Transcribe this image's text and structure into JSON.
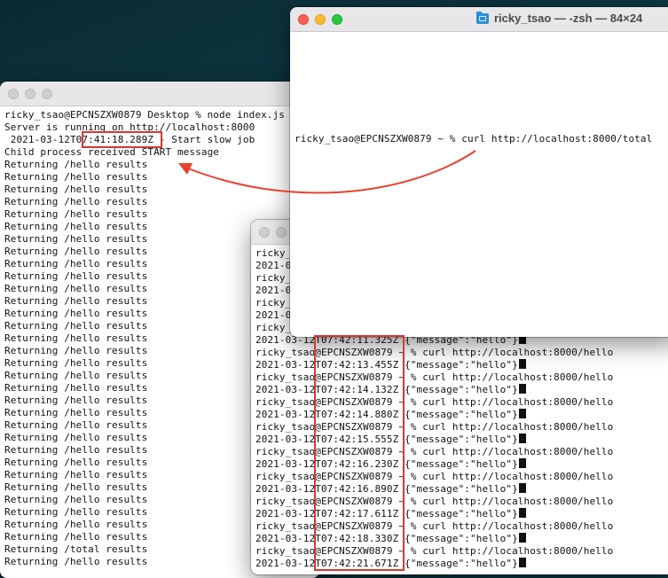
{
  "win_c": {
    "title": "ricky_tsao — -zsh — 84×24",
    "lines": [
      "ricky_tsao@EPCNSZXW0879 ~ % curl http://localhost:8000/total"
    ]
  },
  "win_a": {
    "lines": [
      "ricky_tsao@EPCNSZXW0879 Desktop % node index.js",
      "Server is running on http://localhost:8000",
      " 2021-03-12T07:41:18.289Z - Start slow job",
      "Child process received START message",
      "Returning /hello results",
      "Returning /hello results",
      "Returning /hello results",
      "Returning /hello results",
      "Returning /hello results",
      "Returning /hello results",
      "Returning /hello results",
      "Returning /hello results",
      "Returning /hello results",
      "Returning /hello results",
      "Returning /hello results",
      "Returning /hello results",
      "Returning /hello results",
      "Returning /hello results",
      "Returning /hello results",
      "Returning /hello results",
      "Returning /hello results",
      "Returning /hello results",
      "Returning /hello results",
      "Returning /hello results",
      "Returning /hello results",
      "Returning /hello results",
      "Returning /hello results",
      "Returning /hello results",
      "Returning /hello results",
      "Returning /hello results",
      "Returning /hello results",
      "Returning /hello results",
      "Returning /hello results",
      "Returning /hello results",
      "Returning /hello results",
      "Returning /total results",
      "Returning /hello results"
    ]
  },
  "win_b": {
    "lines": [
      "ricky_",
      "2021-0",
      "ricky_",
      "2021-0",
      "ricky_",
      "2021-0",
      "ricky_",
      "2021-03-12T07:42:11.325Z {\"message\":\"hello\"}",
      "ricky_tsao@EPCNSZXW0879 ~ % curl http://localhost:8000/hello",
      "2021-03-12T07:42:13.455Z {\"message\":\"hello\"}",
      "ricky_tsao@EPCNSZXW0879 ~ % curl http://localhost:8000/hello",
      "2021-03-12T07:42:14.132Z {\"message\":\"hello\"}",
      "ricky_tsao@EPCNSZXW0879 ~ % curl http://localhost:8000/hello",
      "2021-03-12T07:42:14.880Z {\"message\":\"hello\"}",
      "ricky_tsao@EPCNSZXW0879 ~ % curl http://localhost:8000/hello",
      "2021-03-12T07:42:15.555Z {\"message\":\"hello\"}",
      "ricky_tsao@EPCNSZXW0879 ~ % curl http://localhost:8000/hello",
      "2021-03-12T07:42:16.230Z {\"message\":\"hello\"}",
      "ricky_tsao@EPCNSZXW0879 ~ % curl http://localhost:8000/hello",
      "2021-03-12T07:42:16.890Z {\"message\":\"hello\"}",
      "ricky_tsao@EPCNSZXW0879 ~ % curl http://localhost:8000/hello",
      "2021-03-12T07:42:17.611Z {\"message\":\"hello\"}",
      "ricky_tsao@EPCNSZXW0879 ~ % curl http://localhost:8000/hello",
      "2021-03-12T07:42:18.330Z {\"message\":\"hello\"}",
      "ricky_tsao@EPCNSZXW0879 ~ % curl http://localhost:8000/hello",
      "2021-03-12T07:42:21.671Z {\"message\":\"hello\"}"
    ]
  },
  "colors": {
    "annotation": "#d23a30",
    "text": "#111111",
    "titlebar": "#e8e6e8"
  }
}
